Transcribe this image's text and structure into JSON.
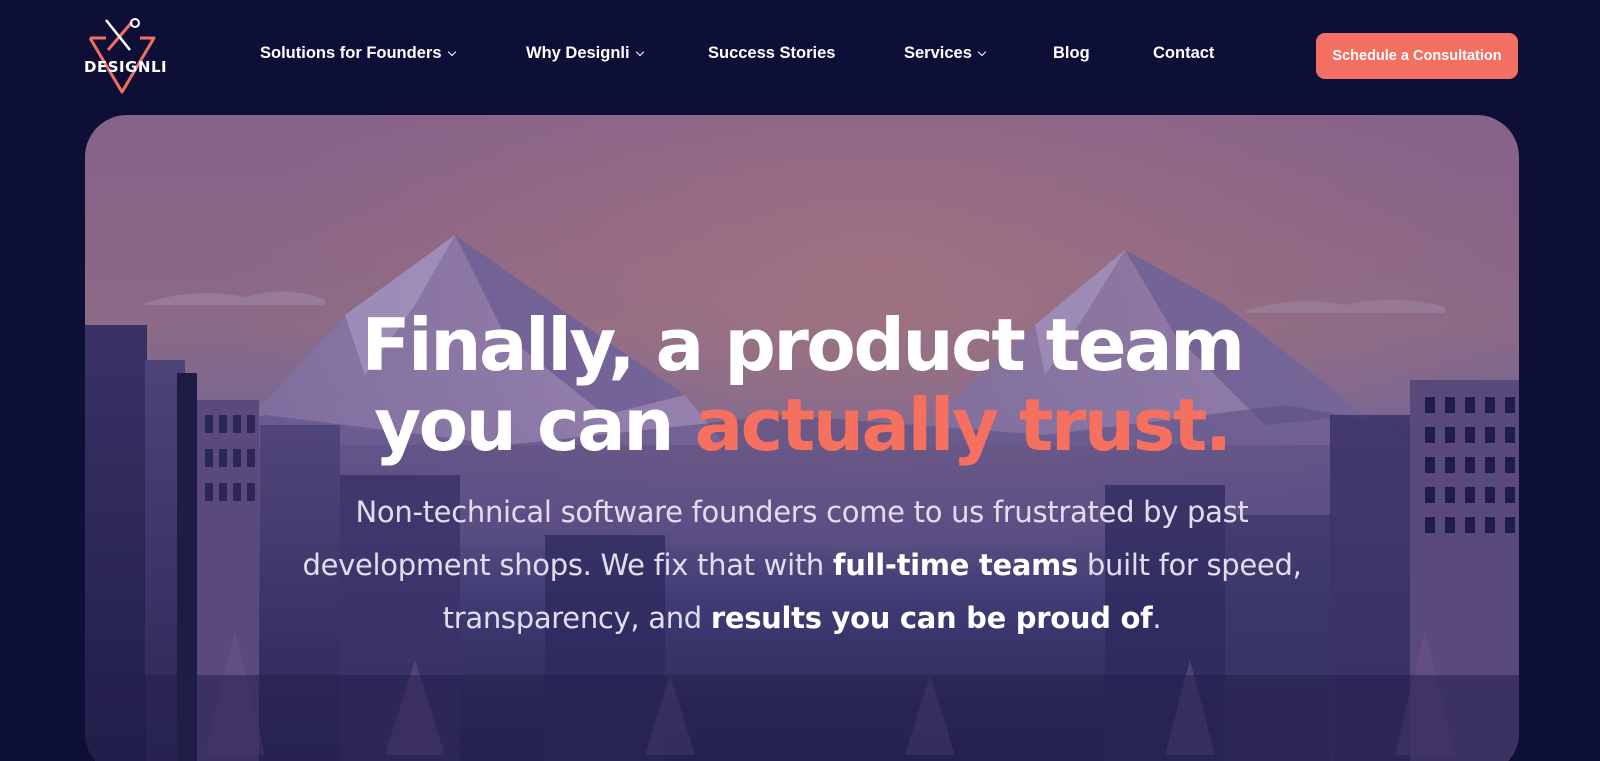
{
  "brand": {
    "name": "DESIGNLI"
  },
  "nav": {
    "items": [
      {
        "label": "Solutions for Founders",
        "has_dropdown": true
      },
      {
        "label": "Why Designli",
        "has_dropdown": true
      },
      {
        "label": "Success Stories",
        "has_dropdown": false
      },
      {
        "label": "Services",
        "has_dropdown": true
      },
      {
        "label": "Blog",
        "has_dropdown": false
      },
      {
        "label": "Contact",
        "has_dropdown": false
      }
    ],
    "cta_label": "Schedule a Consultation"
  },
  "hero": {
    "title_line1": "Finally, a product team",
    "title_line2_prefix": "you can",
    "title_line2_accent": "actually trust.",
    "sub_part1": "Non-technical software founders come to us frustrated by past",
    "sub_part2": "development shops. We fix that with",
    "sub_bold1": "full-time teams",
    "sub_part3": "built for speed,",
    "sub_part4": "transparency, and",
    "sub_bold2": "results you can be proud of",
    "sub_part5": "."
  },
  "colors": {
    "background": "#0e0f36",
    "accent": "#f26f61",
    "text": "#ffffff"
  },
  "icons": {
    "logo": "tools-triangle-icon",
    "dropdown": "chevron-down-icon"
  }
}
